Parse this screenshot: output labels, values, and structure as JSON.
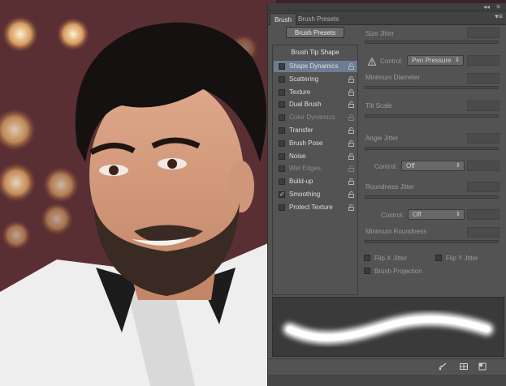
{
  "panel": {
    "tabs": [
      "Brush",
      "Brush Presets"
    ],
    "presets_button": "Brush Presets",
    "list_header": "Brush Tip Shape",
    "items": [
      {
        "label": "Shape Dynamics",
        "checked": false,
        "selected": true,
        "disabled": false
      },
      {
        "label": "Scattering",
        "checked": false,
        "selected": false,
        "disabled": false
      },
      {
        "label": "Texture",
        "checked": false,
        "selected": false,
        "disabled": false
      },
      {
        "label": "Dual Brush",
        "checked": false,
        "selected": false,
        "disabled": false
      },
      {
        "label": "Color Dynamics",
        "checked": false,
        "selected": false,
        "disabled": true
      },
      {
        "label": "Transfer",
        "checked": false,
        "selected": false,
        "disabled": false
      },
      {
        "label": "Brush Pose",
        "checked": false,
        "selected": false,
        "disabled": false
      },
      {
        "label": "Noise",
        "checked": false,
        "selected": false,
        "disabled": false
      },
      {
        "label": "Wet Edges",
        "checked": false,
        "selected": false,
        "disabled": true
      },
      {
        "label": "Build-up",
        "checked": false,
        "selected": false,
        "disabled": false
      },
      {
        "label": "Smoothing",
        "checked": true,
        "selected": false,
        "disabled": false
      },
      {
        "label": "Protect Texture",
        "checked": false,
        "selected": false,
        "disabled": false
      }
    ],
    "controls": {
      "size_jitter": "Size Jitter",
      "control_label": "Control:",
      "size_control_value": "Pen Pressure",
      "minimum_diameter": "Minimum Diameter",
      "tilt_scale": "Tilt Scale",
      "angle_jitter": "Angle Jitter",
      "angle_control_value": "Off",
      "roundness_jitter": "Roundness Jitter",
      "roundness_control_value": "Off",
      "minimum_roundness": "Minimum Roundness",
      "flip_x": "Flip X Jitter",
      "flip_y": "Flip Y Jitter",
      "brush_projection": "Brush Projection"
    },
    "icons": [
      "collapse-icon",
      "close-icon",
      "panel-menu-icon",
      "warning-icon",
      "lock-icon",
      "brush-toggle-icon",
      "grid-icon",
      "new-preset-icon"
    ],
    "colors": {
      "panel": "#535353",
      "selected": "#6c7c92"
    }
  }
}
